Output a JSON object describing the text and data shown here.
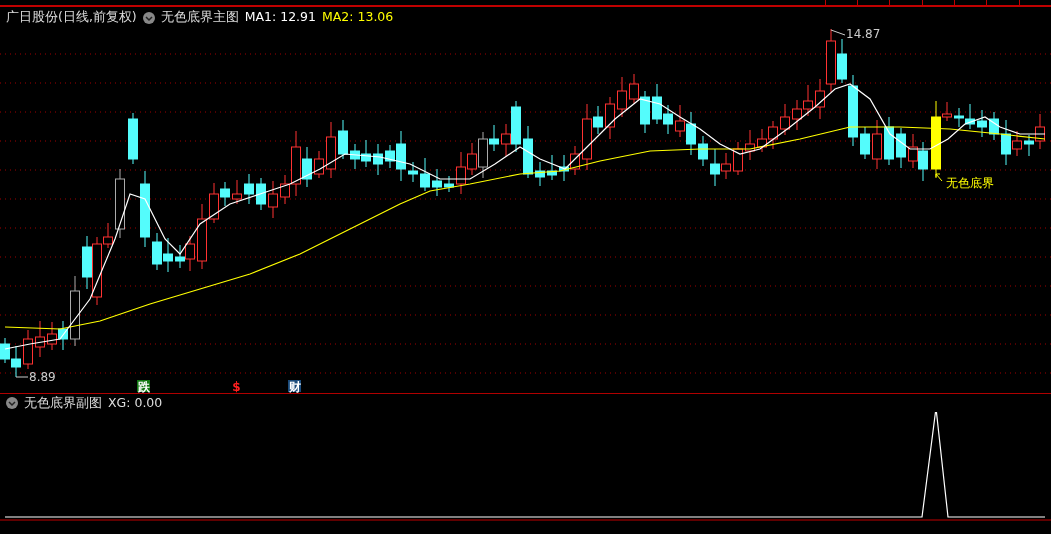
{
  "main_pane": {
    "title": "广日股份(日线,前复权)",
    "indicator": "无色底界主图",
    "ma1": "MA1: 12.91",
    "ma2": "MA2: 13.06",
    "high_label": "14.87",
    "low_label": "8.89",
    "signal_label": "无色底界",
    "event_markers": [
      {
        "label": "跌",
        "kind": "fall"
      },
      {
        "label": "$",
        "kind": "dollar"
      },
      {
        "label": "财",
        "kind": "finance"
      }
    ]
  },
  "sub_pane": {
    "indicator": "无色底界副图",
    "reading": "XG: 0.00"
  }
}
